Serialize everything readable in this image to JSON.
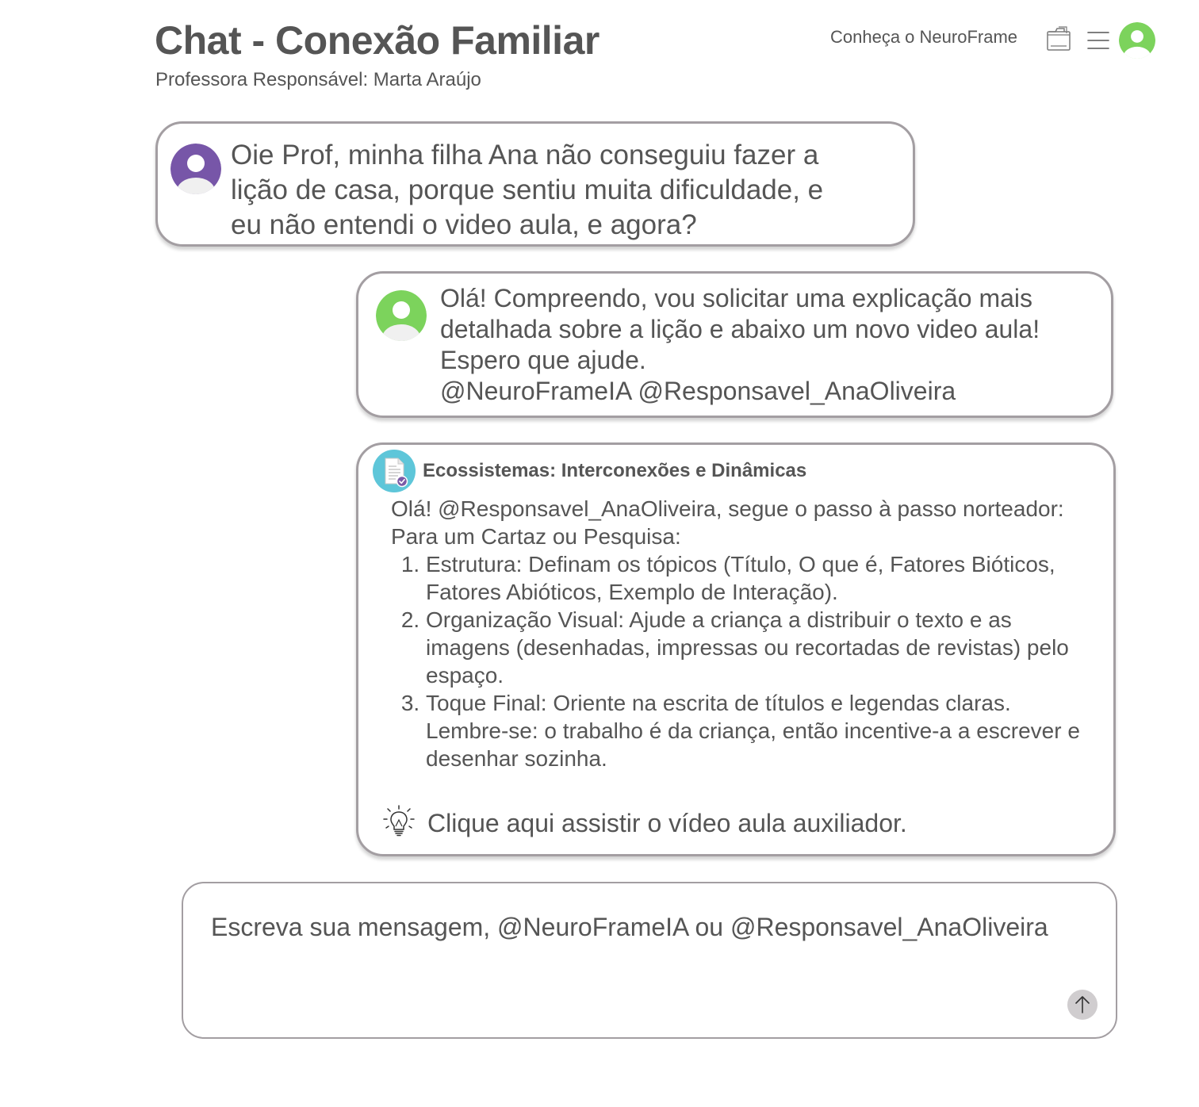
{
  "header": {
    "title": "Chat - Conexão Familiar",
    "subtitle": "Professora Responsável: Marta Araújo",
    "nav_link": "Conheça o NeuroFrame",
    "icons": [
      "documents-icon",
      "menu-icon",
      "user-avatar-icon"
    ]
  },
  "messages": [
    {
      "sender_avatar_color": "#7756a8",
      "text": "Oie Prof, minha filha Ana não conseguiu fazer a\nlição de casa, porque sentiu muita dificuldade, e\neu não entendi o video aula, e agora?"
    },
    {
      "sender_avatar_color": "#7cd35c",
      "text": "Olá! Compreendo, vou solicitar uma explicação mais\ndetalhada sobre a lição e abaixo um novo video aula!\nEspero que ajude.\n@NeuroFrameIA @Responsavel_AnaOliveira"
    }
  ],
  "ai_card": {
    "badge_color": "#5ec6d9",
    "title": "Ecossistemas: Interconexões e Dinâmicas",
    "greeting": "Olá! @Responsavel_AnaOliveira, segue o passo à passo norteador:",
    "intro": "Para um Cartaz ou Pesquisa:",
    "steps": [
      "Estrutura: Definam os tópicos (Título, O que é, Fatores Bióticos, Fatores Abióticos, Exemplo de Interação).",
      "Organização Visual: Ajude a criança a distribuir o texto e as imagens (desenhadas, impressas ou recortadas de revistas) pelo espaço.",
      "Toque Final: Oriente na escrita de títulos e legendas claras. Lembre-se: o trabalho é da criança, então incentive-a a escrever e desenhar sozinha."
    ],
    "video_link": "Clique aqui assistir o vídeo aula auxiliador."
  },
  "composer": {
    "placeholder": "Escreva sua mensagem, @NeuroFrameIA ou @Responsavel_AnaOliveira",
    "value": ""
  },
  "colors": {
    "text": "#555555",
    "bubble_border": "#a39ea2",
    "parent_avatar": "#7756a8",
    "teacher_avatar": "#7cd35c",
    "doc_badge": "#5ec6d9",
    "send_button": "#d0cdcf"
  }
}
